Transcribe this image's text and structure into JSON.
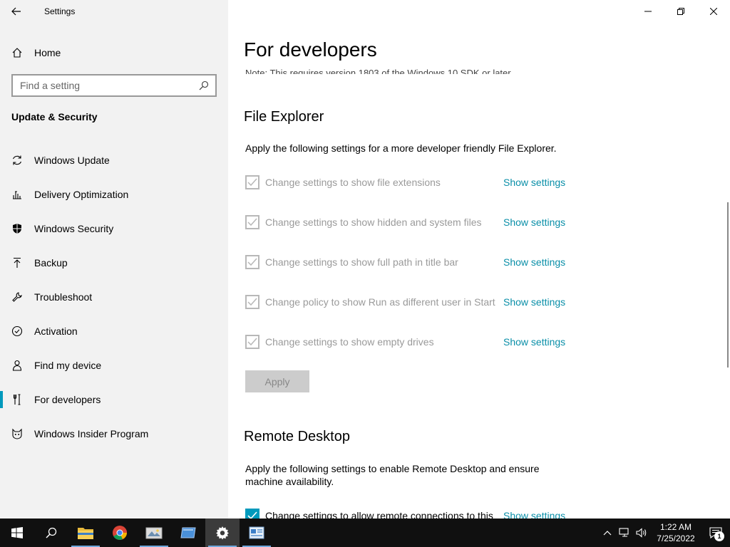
{
  "window": {
    "title": "Settings"
  },
  "sidebar": {
    "home_label": "Home",
    "search_placeholder": "Find a setting",
    "section": "Update & Security",
    "items": [
      {
        "label": "Windows Update",
        "icon": "sync-icon"
      },
      {
        "label": "Delivery Optimization",
        "icon": "delivery-icon"
      },
      {
        "label": "Windows Security",
        "icon": "shield-icon"
      },
      {
        "label": "Backup",
        "icon": "backup-arrow-icon"
      },
      {
        "label": "Troubleshoot",
        "icon": "wrench-icon"
      },
      {
        "label": "Activation",
        "icon": "check-circle-icon"
      },
      {
        "label": "Find my device",
        "icon": "person-icon"
      },
      {
        "label": "For developers",
        "icon": "developer-icon",
        "selected": true
      },
      {
        "label": "Windows Insider Program",
        "icon": "insider-cat-icon"
      }
    ]
  },
  "main": {
    "title": "For developers",
    "cut_note": "Note: This requires version 1803 of the Windows 10 SDK or later.",
    "file_explorer": {
      "heading": "File Explorer",
      "description": "Apply the following settings for a more developer friendly File Explorer.",
      "options": [
        {
          "label": "Change settings to show file extensions",
          "link": "Show settings"
        },
        {
          "label": "Change settings to show hidden and system files",
          "link": "Show settings"
        },
        {
          "label": "Change settings to show full path in title bar",
          "link": "Show settings"
        },
        {
          "label": "Change policy to show Run as different user in Start",
          "link": "Show settings"
        },
        {
          "label": "Change settings to show empty drives",
          "link": "Show settings"
        }
      ],
      "apply_label": "Apply"
    },
    "remote_desktop": {
      "heading": "Remote Desktop",
      "description": "Apply the following settings to enable Remote Desktop and ensure machine availability.",
      "option": {
        "label": "Change settings to allow remote connections to this",
        "link": "Show settings"
      }
    }
  },
  "taskbar": {
    "clock_time": "1:22 AM",
    "clock_date": "7/25/2022",
    "notification_count": "1"
  },
  "colors": {
    "accent": "#0099bc",
    "link": "#0a8fa8",
    "sidebar_bg": "#f2f2f2",
    "taskbar_bg": "#101010"
  }
}
